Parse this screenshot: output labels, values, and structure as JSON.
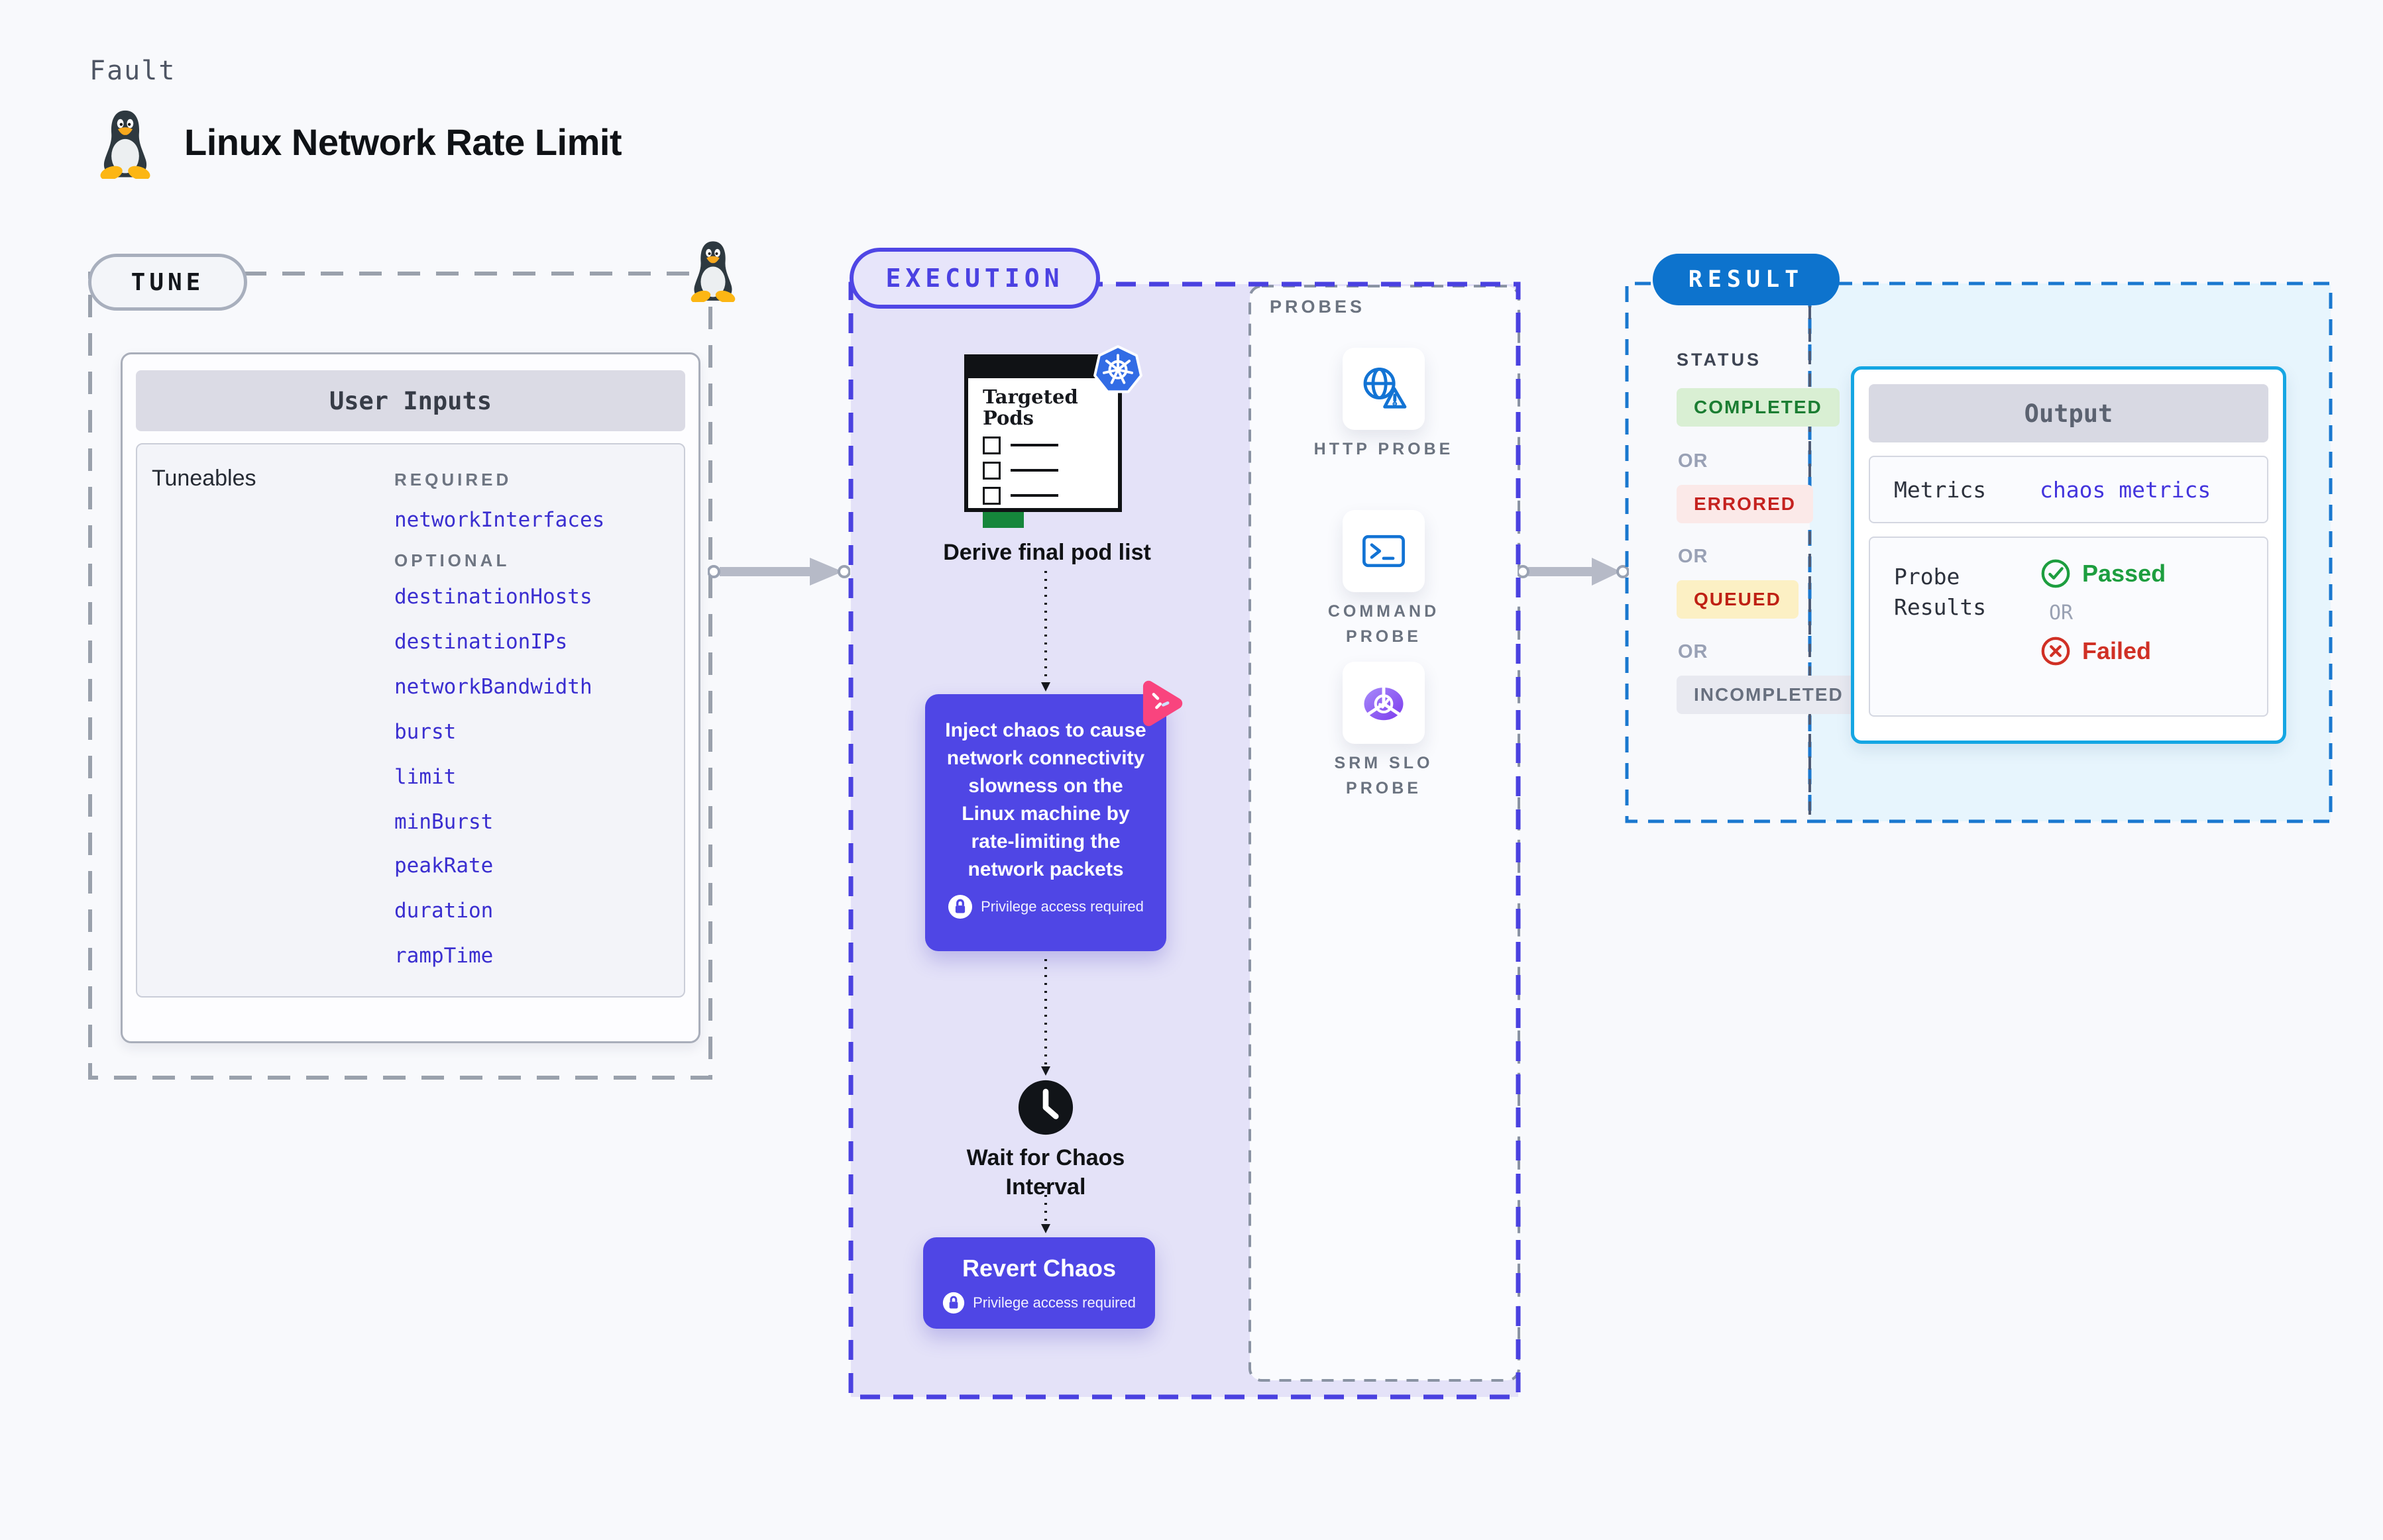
{
  "header": {
    "eyebrow": "Fault",
    "title": "Linux Network Rate Limit"
  },
  "tune": {
    "pill": "TUNE",
    "panel_title": "User Inputs",
    "row_label": "Tuneables",
    "required_heading": "REQUIRED",
    "optional_heading": "OPTIONAL",
    "required_items": [
      "networkInterfaces"
    ],
    "optional_items": [
      "destinationHosts",
      "destinationIPs",
      "networkBandwidth",
      "burst",
      "limit",
      "minBurst",
      "peakRate",
      "duration",
      "rampTime"
    ]
  },
  "execution": {
    "pill": "EXECUTION",
    "targeted_pods_title": "Targeted Pods",
    "derive_label": "Derive final pod list",
    "inject_text": "Inject chaos to cause network connectivity slowness on the Linux machine by rate-limiting the network packets",
    "privilege_label": "Privilege access required",
    "wait_label": "Wait for Chaos Interval",
    "revert_title": "Revert Chaos",
    "probes_heading": "PROBES",
    "probes": [
      {
        "label": "HTTP PROBE",
        "icon": "globe-warning-icon"
      },
      {
        "label": "COMMAND PROBE",
        "icon": "terminal-icon"
      },
      {
        "label": "SRM SLO PROBE",
        "icon": "slo-donut-icon"
      }
    ]
  },
  "result": {
    "pill": "RESULT",
    "status_heading": "STATUS",
    "or_label": "OR",
    "statuses": [
      {
        "label": "COMPLETED",
        "bg": "#d9efd3",
        "color": "#1b7d32"
      },
      {
        "label": "ERRORED",
        "bg": "#fbe9e8",
        "color": "#c5221f"
      },
      {
        "label": "QUEUED",
        "bg": "#fcf0c4",
        "color": "#bf2114"
      },
      {
        "label": "INCOMPLETED",
        "bg": "#e8e9f0",
        "color": "#68707f"
      }
    ],
    "output": {
      "title": "Output",
      "metrics_label": "Metrics",
      "metrics_value": "chaos metrics",
      "probe_results_label": "Probe Results",
      "passed_label": "Passed",
      "or_label": "OR",
      "failed_label": "Failed"
    }
  },
  "colors": {
    "accent_indigo": "#4f46e5",
    "accent_blue": "#0d73cd",
    "accent_cyan": "#15a6e3",
    "passed_green": "#1d9e3f",
    "failed_red": "#d03025",
    "link_indigo": "#4334dd",
    "lavender_fill": "#e4e2f8",
    "lightblue_fill": "#e7f5fd"
  }
}
